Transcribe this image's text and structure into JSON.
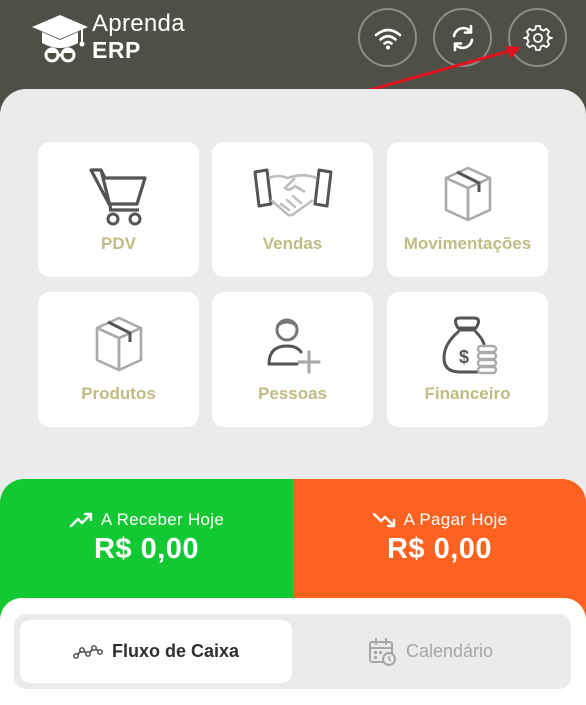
{
  "app": {
    "logo_line1": "Aprenda",
    "logo_line2": "ERP"
  },
  "header_buttons": [
    {
      "icon": "wifi-icon"
    },
    {
      "icon": "sync-icon"
    },
    {
      "icon": "gear-icon"
    }
  ],
  "tiles": [
    {
      "label": "PDV",
      "icon": "cart-icon"
    },
    {
      "label": "Vendas",
      "icon": "handshake-icon"
    },
    {
      "label": "Movimentações",
      "icon": "box-icon"
    },
    {
      "label": "Produtos",
      "icon": "box-icon"
    },
    {
      "label": "Pessoas",
      "icon": "add-person-icon"
    },
    {
      "label": "Financeiro",
      "icon": "money-bag-icon"
    }
  ],
  "summary": {
    "receive_title": "A Receber Hoje",
    "receive_value": "R$ 0,00",
    "pay_title": "A Pagar Hoje",
    "pay_value": "R$ 0,00"
  },
  "tabs": [
    {
      "label": "Fluxo de Caixa",
      "icon": "cash-flow-icon",
      "active": true
    },
    {
      "label": "Calendário",
      "icon": "calendar-icon",
      "active": false
    }
  ],
  "colors": {
    "header_bg": "#4f4f47",
    "tile_label": "#c1bb84",
    "receive_bg": "#12c934",
    "pay_bg": "#fd6220",
    "annotation_arrow": "#e0141e"
  }
}
